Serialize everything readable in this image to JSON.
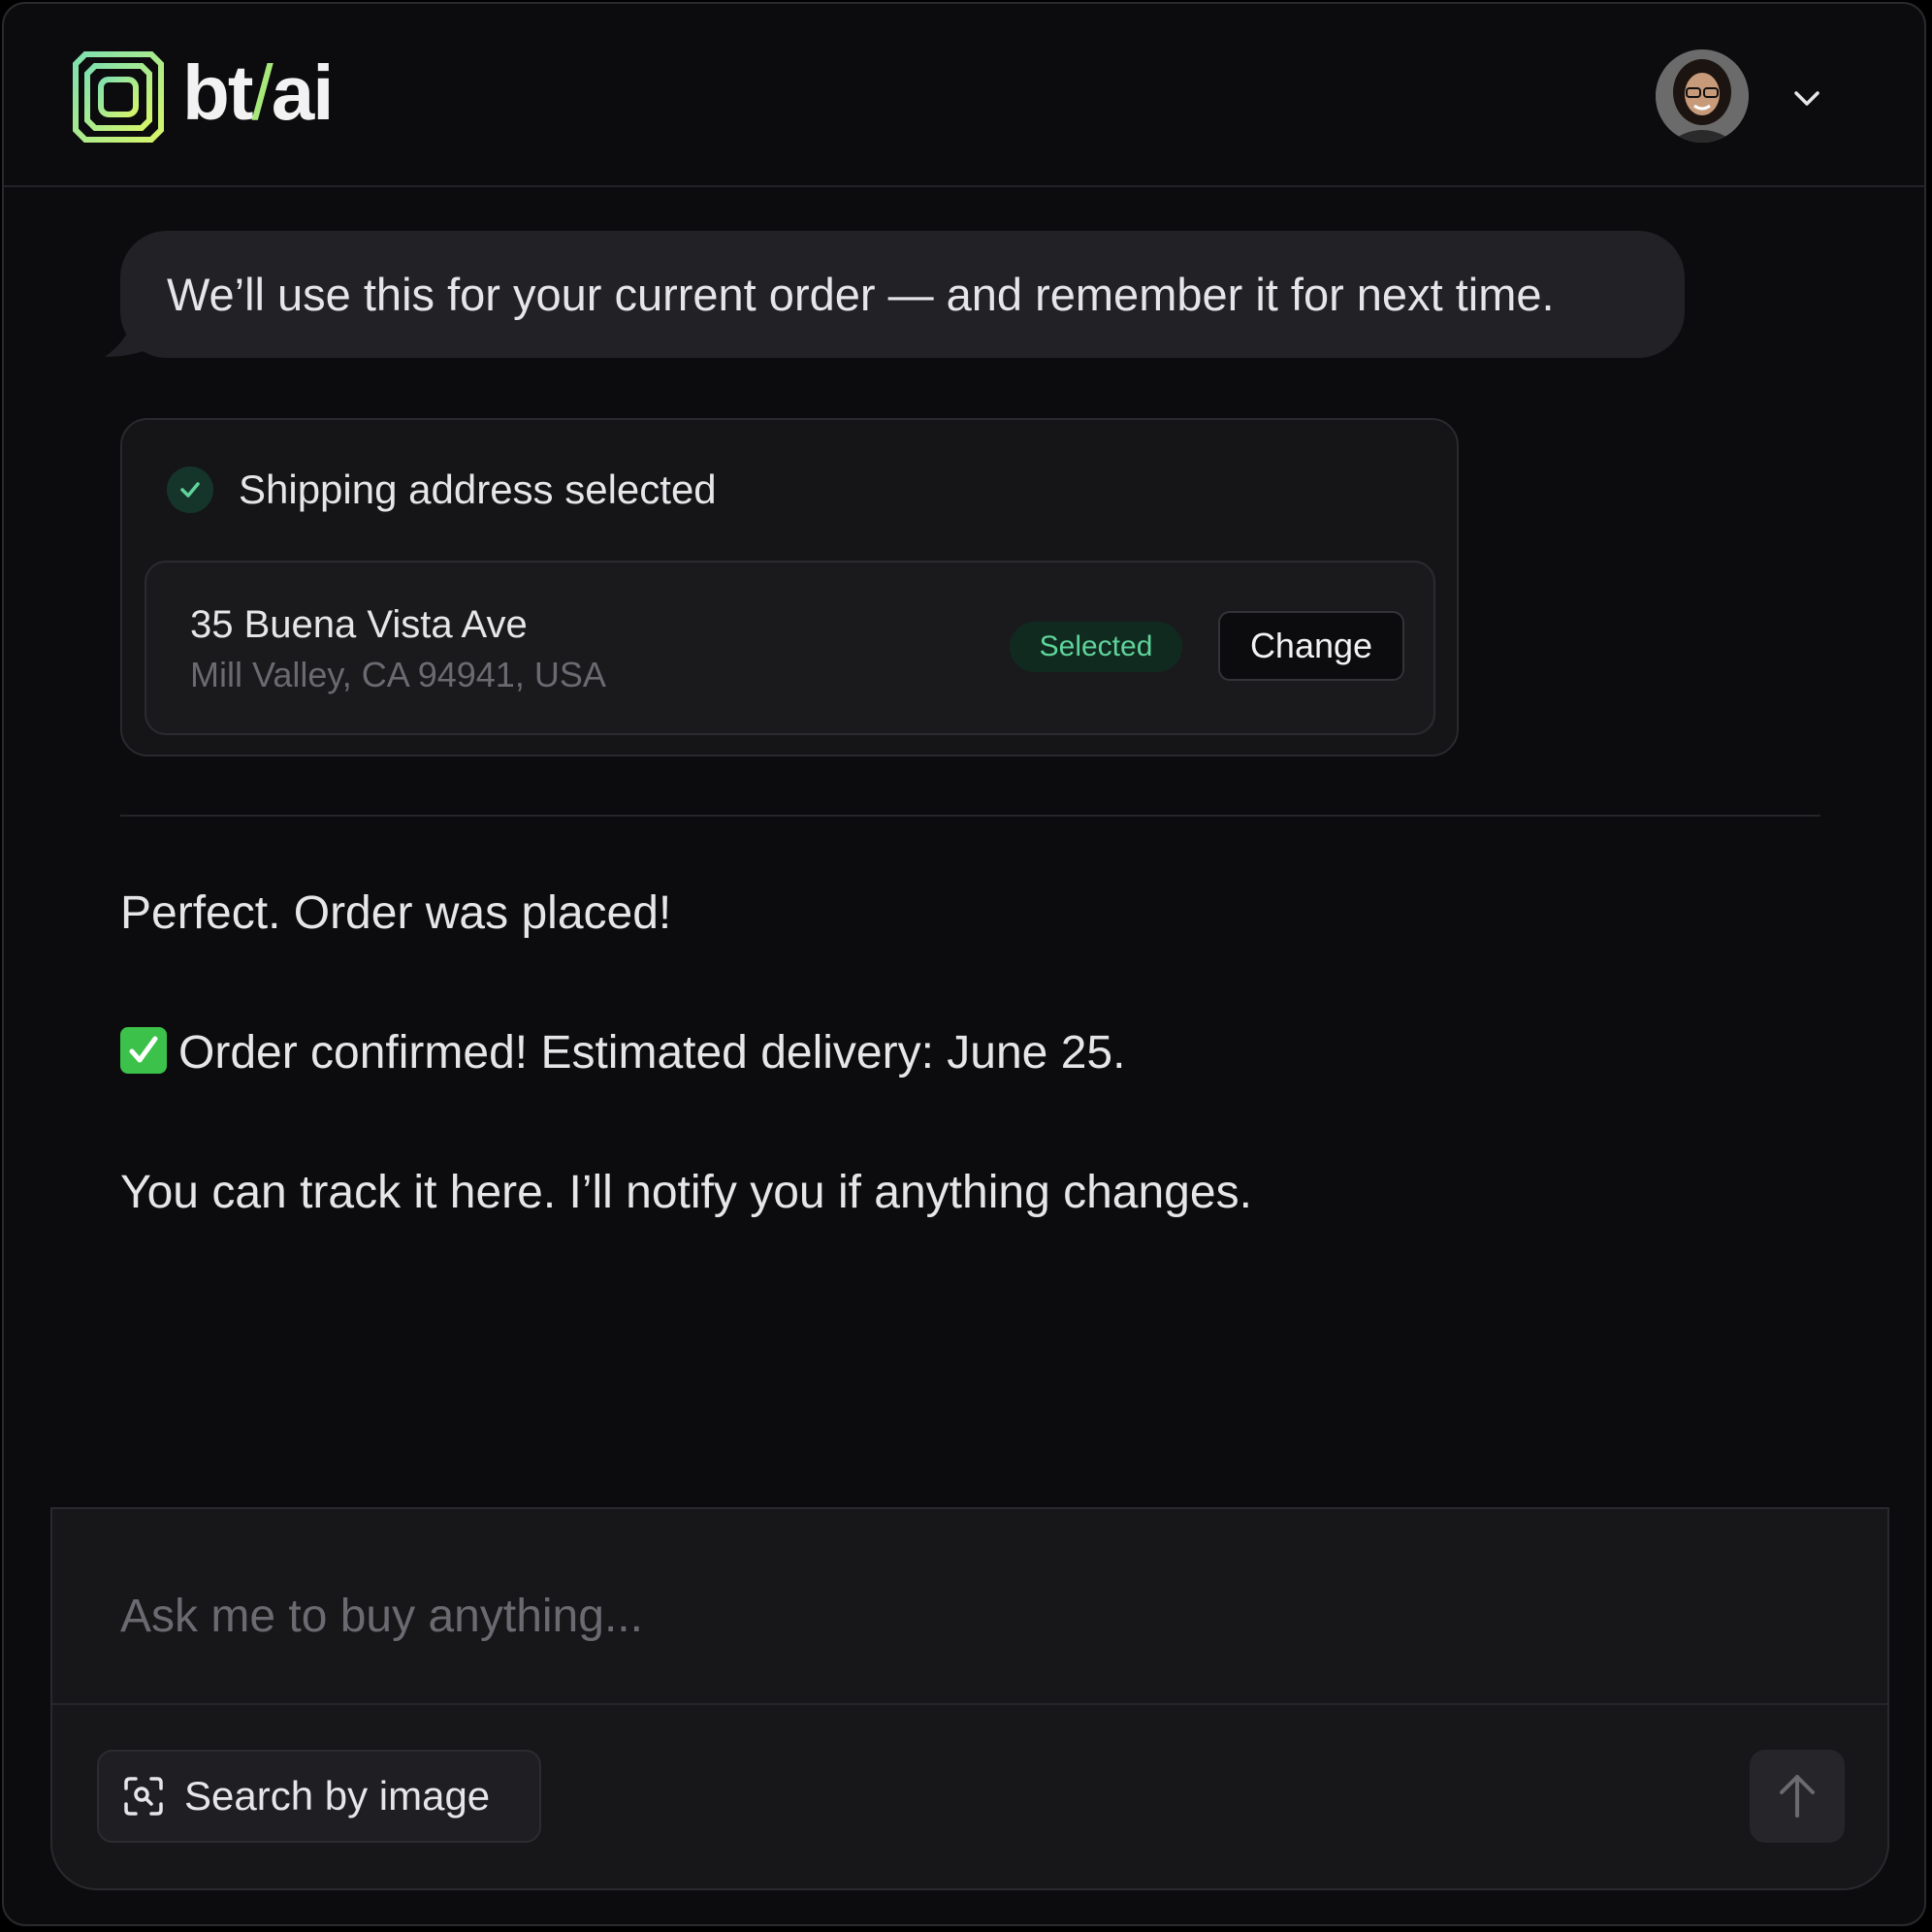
{
  "app": {
    "logo_text_left": "bt",
    "logo_text_slash": "/",
    "logo_text_right": "ai",
    "accent_color": "#a6e87a"
  },
  "header": {
    "avatar_alt": "User avatar",
    "menu_icon": "chevron-down-icon"
  },
  "chat": {
    "bubble_text": "We’ll use this for your current order — and remember it for next time.",
    "shipping_card": {
      "title": "Shipping address selected",
      "status_icon": "check-icon",
      "address_line1": "35 Buena Vista Ave",
      "address_line2": "Mill Valley, CA 94941, USA",
      "badge_label": "Selected",
      "badge_color": "#5fd39a",
      "change_label": "Change"
    },
    "messages": [
      "Perfect. Order was placed!",
      "Order confirmed! Estimated delivery: June 25.",
      "You can track it here. I’ll notify you if anything changes."
    ]
  },
  "composer": {
    "placeholder": "Ask me to buy anything...",
    "value": "",
    "search_by_image_label": "Search by image",
    "search_icon": "image-search-icon",
    "send_icon": "arrow-up-icon"
  }
}
